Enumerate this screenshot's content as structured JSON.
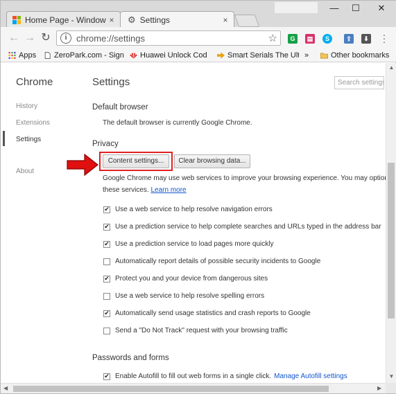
{
  "tabs": [
    {
      "title": "Home Page - Windows T",
      "close": "×"
    },
    {
      "title": "Settings",
      "close": "×"
    }
  ],
  "window_controls": {
    "minimize": "—",
    "maximize": "☐",
    "close": "✕"
  },
  "toolbar": {
    "back": "←",
    "forward": "→",
    "reload": "↻",
    "info": "i",
    "url": "chrome://settings",
    "star": "☆"
  },
  "extensions": [
    {
      "name": "grammarly-icon",
      "color": "#15a047",
      "glyph": "G"
    },
    {
      "name": "pocket-icon",
      "color": "#d6336c",
      "glyph": "▤"
    },
    {
      "name": "skype-icon",
      "color": "#00aff0",
      "glyph": "S"
    },
    {
      "name": "upload-icon",
      "color": "#4a7fc1",
      "glyph": "⇪"
    },
    {
      "name": "download-icon",
      "color": "#555555",
      "glyph": "⬇"
    }
  ],
  "bookmarks": {
    "apps": "Apps",
    "items": [
      {
        "label": "ZeroPark.com - Sign i"
      },
      {
        "label": "Huawei Unlock Code"
      },
      {
        "label": "Smart Serials The Ulti"
      }
    ],
    "more": "»",
    "other": "Other bookmarks"
  },
  "sidebar": {
    "title": "Chrome",
    "items": [
      {
        "label": "History"
      },
      {
        "label": "Extensions"
      },
      {
        "label": "Settings"
      },
      {
        "label": "About"
      }
    ]
  },
  "main": {
    "title": "Settings",
    "search_placeholder": "Search settings",
    "default_browser": {
      "heading": "Default browser",
      "text": "The default browser is currently Google Chrome."
    },
    "privacy": {
      "heading": "Privacy",
      "content_settings_button": "Content settings...",
      "clear_data_button": "Clear browsing data...",
      "desc_line1": "Google Chrome may use web services to improve your browsing experience. You may option",
      "desc_line2": "these services.",
      "learn_more": "Learn more",
      "options": [
        {
          "label": "Use a web service to help resolve navigation errors",
          "checked": true
        },
        {
          "label": "Use a prediction service to help complete searches and URLs typed in the address bar",
          "checked": true
        },
        {
          "label": "Use a prediction service to load pages more quickly",
          "checked": true
        },
        {
          "label": "Automatically report details of possible security incidents to Google",
          "checked": false
        },
        {
          "label": "Protect you and your device from dangerous sites",
          "checked": true
        },
        {
          "label": "Use a web service to help resolve spelling errors",
          "checked": false
        },
        {
          "label": "Automatically send usage statistics and crash reports to Google",
          "checked": true
        },
        {
          "label": "Send a \"Do Not Track\" request with your browsing traffic",
          "checked": false
        }
      ]
    },
    "passwords": {
      "heading": "Passwords and forms",
      "autofill_label": "Enable Autofill to fill out web forms in a single click.",
      "autofill_checked": true,
      "manage_link": "Manage Autofill settings"
    }
  },
  "colors": {
    "highlight": "#e02020",
    "arrow": "#e01010",
    "link": "#1155cc"
  }
}
